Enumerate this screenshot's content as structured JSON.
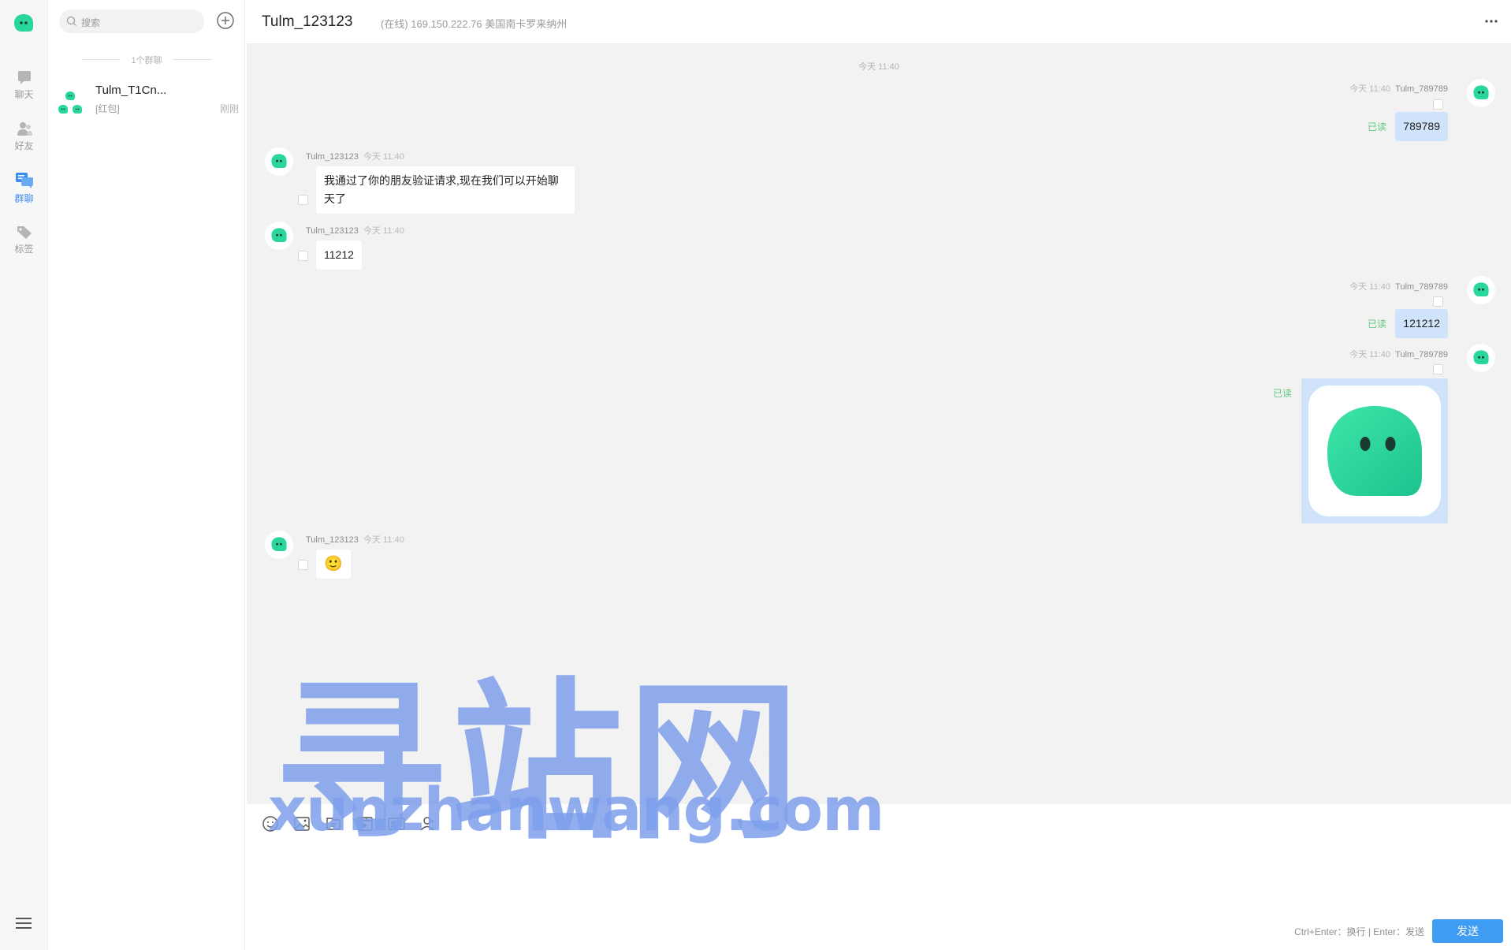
{
  "nav": {
    "items": [
      {
        "label": "聊天",
        "icon": "chat-icon"
      },
      {
        "label": "好友",
        "icon": "friends-icon"
      },
      {
        "label": "群聊",
        "icon": "group-chat-icon"
      },
      {
        "label": "标签",
        "icon": "tag-icon"
      }
    ],
    "active_index": 2
  },
  "search": {
    "placeholder": "搜索"
  },
  "conversations": {
    "group_count_label": "1个群聊",
    "items": [
      {
        "name": "Tulm_T1Cn...",
        "last_message": "[红包]",
        "time": "刚刚"
      }
    ]
  },
  "chat": {
    "title": "Tulm_123123",
    "status": "(在线) 169.150.222.76 美国南卡罗来纳州",
    "system_time": "今天 11:40",
    "messages": [
      {
        "direction": "out",
        "time": "今天 11:40",
        "sender": "Tulm_789789",
        "text": "789789",
        "read": "已读"
      },
      {
        "direction": "in",
        "sender": "Tulm_123123",
        "time": "今天 11:40",
        "text": "我通过了你的朋友验证请求,现在我们可以开始聊天了"
      },
      {
        "direction": "in",
        "sender": "Tulm_123123",
        "time": "今天 11:40",
        "text": "11212"
      },
      {
        "direction": "out",
        "time": "今天 11:40",
        "sender": "Tulm_789789",
        "text": "121212",
        "read": "已读"
      },
      {
        "direction": "out",
        "time": "今天 11:40",
        "sender": "Tulm_789789",
        "type": "image",
        "read": "已读"
      },
      {
        "direction": "in",
        "sender": "Tulm_123123",
        "time": "今天 11:40",
        "text": "🙂"
      }
    ]
  },
  "composer": {
    "tools": [
      "emoji-icon",
      "image-icon",
      "file-icon",
      "video-icon",
      "contact-card-icon",
      "user-icon"
    ],
    "hint": "Ctrl+Enter：换行 | Enter：发送",
    "send_label": "发送"
  },
  "watermark": {
    "cn": "寻站网",
    "en": "xunzhanwang.com"
  },
  "colors": {
    "brand_green": "#2ad79b",
    "accent_blue": "#3e9cf2",
    "read_green": "#5ec97f",
    "out_bubble": "#cfe4fb"
  }
}
